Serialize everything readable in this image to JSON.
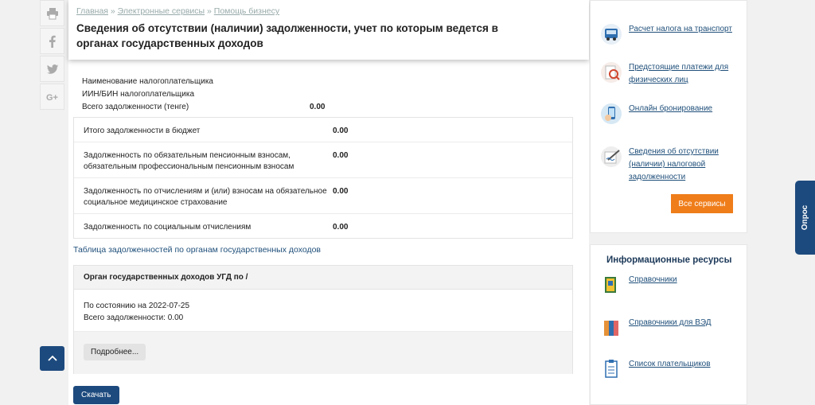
{
  "breadcrumb": {
    "home": "Главная",
    "services": "Электронные сервисы",
    "business": "Помощь бизнесу",
    "sep": " » "
  },
  "page_title": "Сведения об отсутствии (наличии) задолженности, учет по которым ведется в органах государственных доходов",
  "taxpayer": {
    "name_label": "Наименование налогоплательщика",
    "iin_label": "ИИН/БИН налогоплательщика",
    "total_label": "Всего задолженности (тенге)",
    "total_value": "0.00"
  },
  "debt_rows": [
    {
      "label": "Итого задолженности в бюджет",
      "value": "0.00"
    },
    {
      "label": "Задолженность по обязательным пенсионным взносам, обязательным профессиональным пенсионным взносам",
      "value": "0.00"
    },
    {
      "label": "Задолженность по отчислениям и (или) взносам на обязательное социальное медицинское страхование",
      "value": "0.00"
    },
    {
      "label": "Задолженность по социальным отчислениям",
      "value": "0.00"
    }
  ],
  "table_link": "Таблица задолженностей по органам государственных доходов",
  "org_panel": {
    "header": "Орган государственных доходов УГД по /",
    "as_of": "По состоянию на 2022-07-25",
    "total": "Всего задолженности: 0.00",
    "more_label": "Подробнее..."
  },
  "download_label": "Скачать",
  "services": [
    {
      "label": "Расчет налога на транспорт",
      "icon": "bus-icon"
    },
    {
      "label": "Предстоящие платежи для физических лиц",
      "icon": "search-document-icon"
    },
    {
      "label": "Онлайн бронирование",
      "icon": "phone-booking-icon"
    },
    {
      "label": "Сведения об отсутствии (наличии) налоговой задолженности",
      "icon": "signature-document-icon"
    }
  ],
  "all_services_label": "Все сервисы",
  "resources": {
    "title": "Информационные ресурсы",
    "items": [
      {
        "label": "Справочники",
        "icon": "book-icon"
      },
      {
        "label": "Справочники для ВЭД",
        "icon": "books-icon"
      },
      {
        "label": "Список плательщиков",
        "icon": "checklist-icon"
      }
    ]
  },
  "poll_label": "Опрос",
  "colors": {
    "accent_blue": "#1d4a7e",
    "orange": "#ef7d1a",
    "link": "#1f4f7a"
  }
}
